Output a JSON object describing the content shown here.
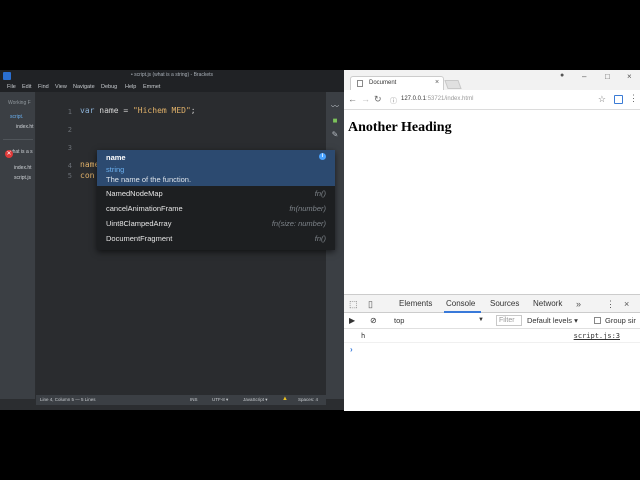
{
  "brackets": {
    "window_title": "• script.js (what is a string) - Brackets",
    "menu": [
      "File",
      "Edit",
      "Find",
      "View",
      "Navigate",
      "Debug",
      "Help",
      "Emmet"
    ],
    "sidebar": {
      "working_files_label": "Working F",
      "working_files": [
        "script.",
        "index.ht"
      ],
      "project_label": "what is a s",
      "project_files": [
        "index.ht",
        "script.js"
      ]
    },
    "editor": {
      "line_numbers": [
        "1",
        "2",
        "3",
        "4",
        "5"
      ],
      "line1_keyword": "var",
      "line1_ident": " name = ",
      "line1_string": "\"Hichem MED\"",
      "line1_end": ";",
      "line4": "name",
      "line5": "con"
    },
    "statusbar": {
      "position": "Line 4, Column 5 — 5 Lines",
      "mode": "INS",
      "encoding": "UTF-8 ▾",
      "language": "JavaScript ▾",
      "spaces": "Spaces: 4"
    }
  },
  "code_hint": {
    "selected": {
      "name": "name",
      "type": "string",
      "doc": "The name of the function."
    },
    "items": [
      {
        "label": "NamedNodeMap",
        "signature": "fn()"
      },
      {
        "label": "cancelAnimationFrame",
        "signature": "fn(number)"
      },
      {
        "label": "Uint8ClampedArray",
        "signature": "fn(size: number)"
      },
      {
        "label": "DocumentFragment",
        "signature": "fn()"
      }
    ]
  },
  "browser": {
    "tab_title": "Document",
    "url_host": "127.0.0.1",
    "url_rest": ":53721/index.html",
    "page_heading": "Another Heading",
    "devtools": {
      "tabs": [
        "Elements",
        "Console",
        "Sources",
        "Network"
      ],
      "active_tab": "Console",
      "context": "top",
      "filter_placeholder": "Filter",
      "levels": "Default levels ▾",
      "group_similar": "Group sir",
      "log_message": "h",
      "log_source": "script.js:3",
      "prompt": "›"
    }
  },
  "colors": {
    "accent_blue": "#3879d9",
    "hint_selected_bg": "#2c4a70",
    "error_red": "#e03a3a"
  }
}
